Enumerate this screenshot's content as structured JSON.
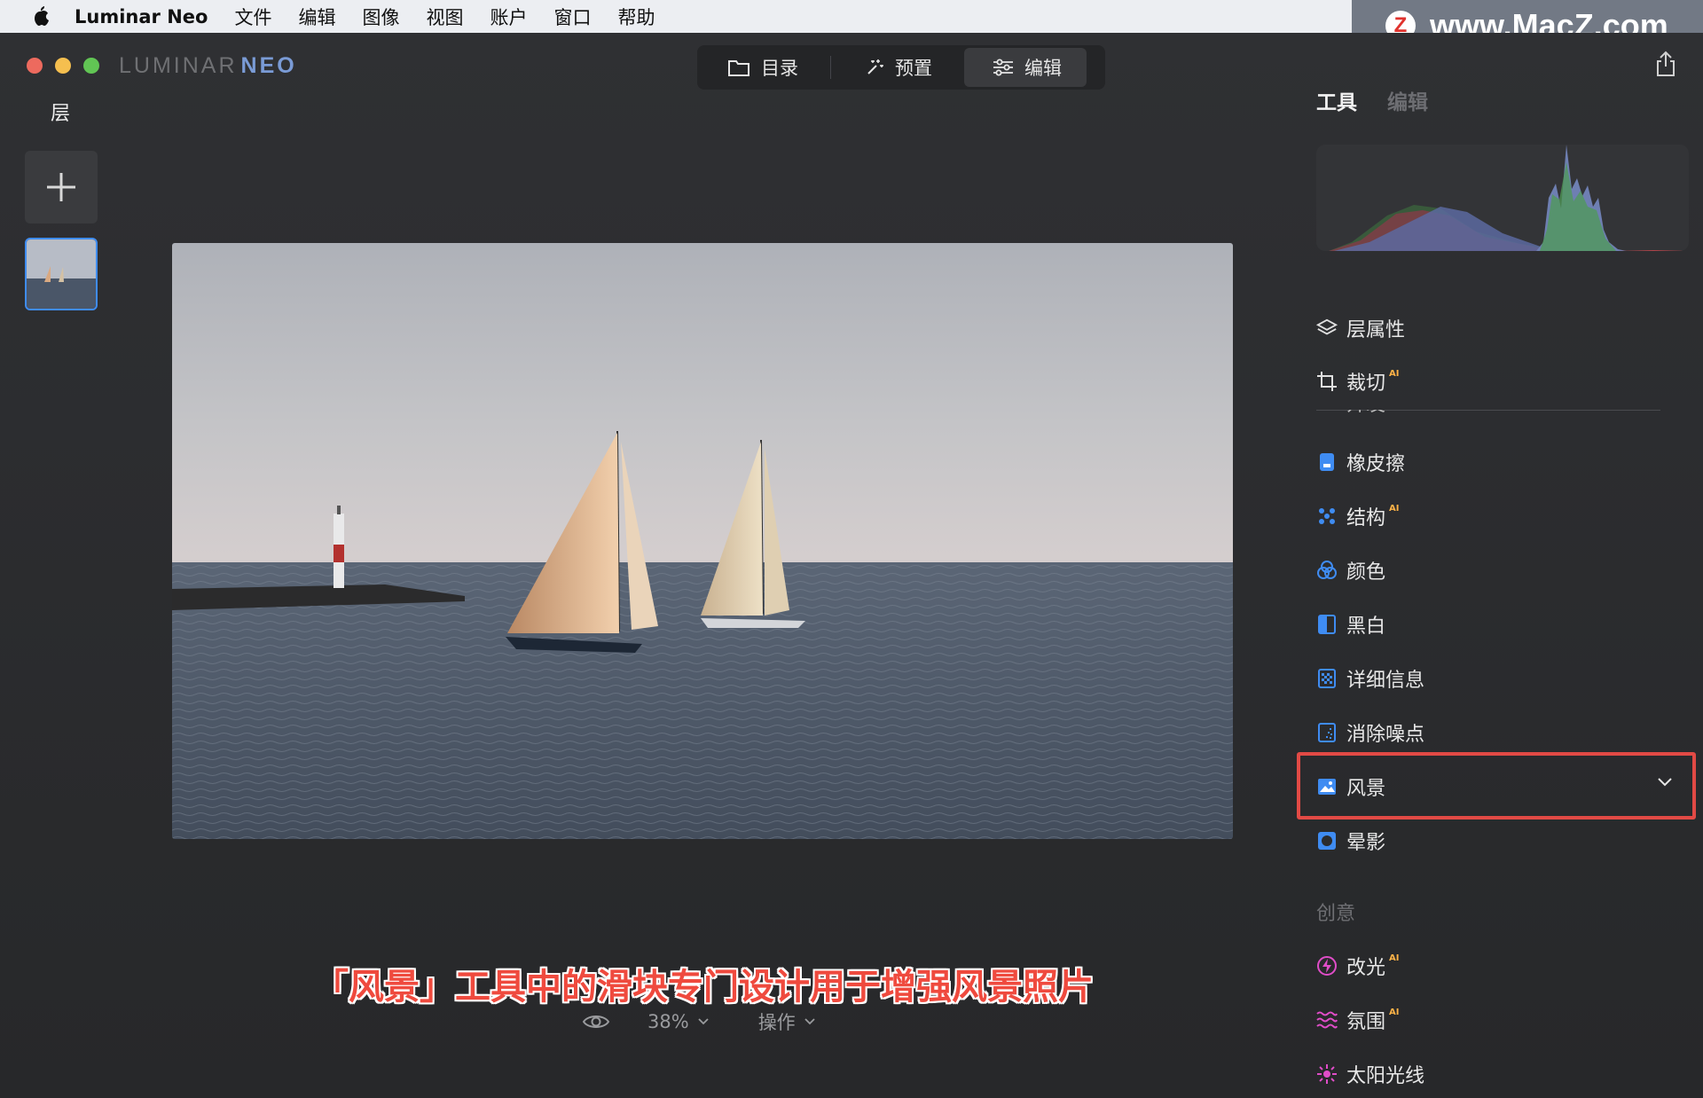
{
  "menubar": {
    "app_name": "Luminar Neo",
    "items": [
      "文件",
      "编辑",
      "图像",
      "视图",
      "账户",
      "窗口",
      "帮助"
    ]
  },
  "watermark": {
    "logo_letter": "Z",
    "text": "www.MacZ.com"
  },
  "brand": {
    "name": "LUMINAR",
    "suffix": "NEO"
  },
  "mode_tabs": [
    {
      "label": "目录",
      "icon": "folder-icon"
    },
    {
      "label": "预置",
      "icon": "magic-wand-icon"
    },
    {
      "label": "编辑",
      "icon": "sliders-icon",
      "active": true
    }
  ],
  "layers": {
    "title": "层"
  },
  "subtitle": "「风景」工具中的滑块专门设计用于增强风景照片",
  "bottom_bar": {
    "zoom": "38%",
    "actions": "操作"
  },
  "panel": {
    "tabs": [
      "工具",
      "编辑"
    ],
    "tools": [
      {
        "label": "层属性",
        "icon": "layers-icon",
        "ai": false
      },
      {
        "label": "裁切",
        "icon": "crop-icon",
        "ai": true
      },
      {
        "label": "橡皮擦",
        "icon": "eraser-icon",
        "ai": false
      },
      {
        "label": "结构",
        "icon": "structure-icon",
        "ai": true
      },
      {
        "label": "颜色",
        "icon": "color-icon",
        "ai": false
      },
      {
        "label": "黑白",
        "icon": "bw-icon",
        "ai": false
      },
      {
        "label": "详细信息",
        "icon": "details-icon",
        "ai": false
      },
      {
        "label": "消除噪点",
        "icon": "denoise-icon",
        "ai": false
      },
      {
        "label": "风景",
        "icon": "landscape-icon",
        "ai": false,
        "highlighted": true
      },
      {
        "label": "晕影",
        "icon": "vignette-icon",
        "ai": false
      }
    ],
    "peek_label": "开发",
    "ai_badge": "AI",
    "creative_label": "创意",
    "creative_tools": [
      {
        "label": "改光",
        "icon": "relight-icon",
        "ai": true
      },
      {
        "label": "氛围",
        "icon": "atmosphere-icon",
        "ai": true
      },
      {
        "label": "太阳光线",
        "icon": "sunrays-icon",
        "ai": false
      }
    ]
  },
  "colors": {
    "accent": "#3f8cf2",
    "highlight": "#e24a45",
    "subtitle": "#ef4a3e",
    "ai_badge": "#ffb347"
  }
}
